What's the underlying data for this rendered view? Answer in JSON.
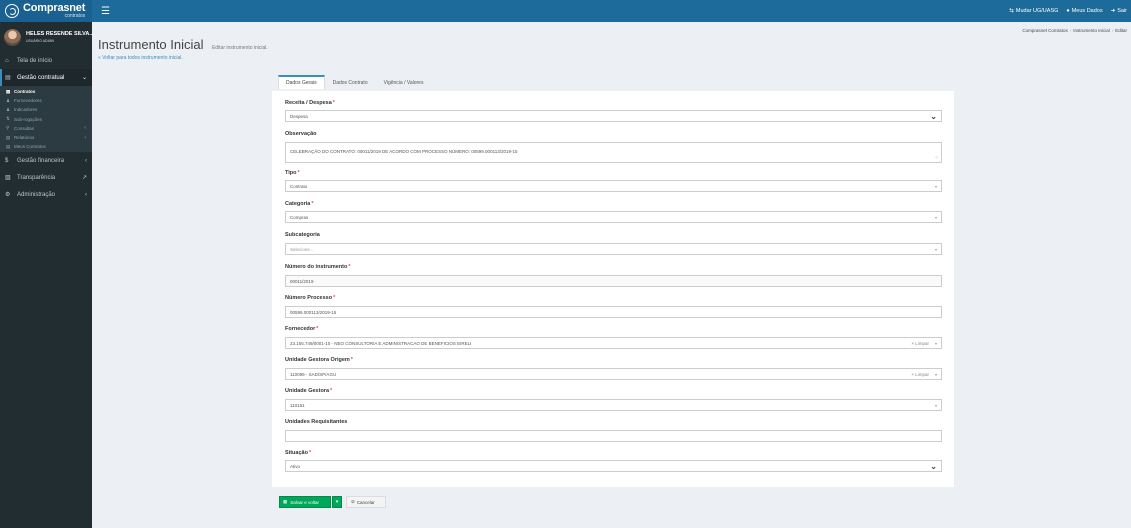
{
  "brand": {
    "title": "Comprasnet",
    "subtitle": "contratos"
  },
  "topbar": {
    "menu_icon": "hamburger-icon",
    "actions": [
      {
        "label": "Mudar UG/UASG",
        "icon": "swap-icon"
      },
      {
        "label": "Meus Dados",
        "icon": "user-icon"
      },
      {
        "label": "Sair",
        "icon": "logout-icon"
      }
    ]
  },
  "user": {
    "name": "HELES RESENDE SILVA...",
    "role": "USUÁRIO ADMIN"
  },
  "sidebar": {
    "items": [
      {
        "label": "Tela de início",
        "icon": "home-icon"
      },
      {
        "label": "Gestão contratual",
        "icon": "file-icon",
        "expanded": true
      },
      {
        "label": "Gestão financeira",
        "icon": "dollar-icon"
      },
      {
        "label": "Transparência",
        "icon": "table-icon"
      },
      {
        "label": "Administração",
        "icon": "gears-icon"
      }
    ],
    "submenu": [
      {
        "label": "Contratos",
        "icon": "file-icon",
        "current": true
      },
      {
        "label": "Fornecedores",
        "icon": "users-icon"
      },
      {
        "label": "Indicadores",
        "icon": "users-icon"
      },
      {
        "label": "Sub-rogações",
        "icon": "exchange-icon"
      },
      {
        "label": "Consultas",
        "icon": "search-icon"
      },
      {
        "label": "Relatórios",
        "icon": "file-icon"
      },
      {
        "label": "Meus Contratos",
        "icon": "file-icon"
      }
    ]
  },
  "header": {
    "title": "Instrumento Inicial",
    "subtitle": "Editar instrumento inicial.",
    "back_link": "« Voltar para todos instrumento inicial."
  },
  "breadcrumb": [
    "Comprasnet Contratos",
    "Instrumento Inicial",
    "Editar"
  ],
  "tabs": [
    {
      "label": "Dados Gerais",
      "active": true
    },
    {
      "label": "Dados Contrato",
      "active": false
    },
    {
      "label": "Vigência / Valores",
      "active": false
    }
  ],
  "form": {
    "receita_despesa": {
      "label": "Receita / Despesa",
      "value": "Despesa"
    },
    "observacao": {
      "label": "Observação",
      "value": "CELEBRAÇÃO DO CONTRATO: 00011/2019 DE ACORDO COM PROCESSO NÚMERO: 00599.000113/2019-15"
    },
    "tipo": {
      "label": "Tipo",
      "value": "Contrato"
    },
    "categoria": {
      "label": "Categoria",
      "value": "Compras"
    },
    "subcategoria": {
      "label": "Subcategoria",
      "placeholder": "Selecione..."
    },
    "numero_instrumento": {
      "label": "Número do instrumento",
      "value": "00011/2019"
    },
    "numero_processo": {
      "label": "Número Processo",
      "value": "00599.000113/2019-15"
    },
    "fornecedor": {
      "label": "Fornecedor",
      "value": "23.155.749/0001-10 - NEO CONSULTORIA E ADMINISTRACAO DE BENEFICIOS EIRELI",
      "clear": "× Limpar"
    },
    "unidade_origem": {
      "label": "Unidade Gestora Origem",
      "value": "110099 - SAD/SP/AGU",
      "clear": "× Limpar"
    },
    "unidade_gestora": {
      "label": "Unidade Gestora",
      "value": "110161"
    },
    "unidades_requisitantes": {
      "label": "Unidades Requisitantes",
      "value": ""
    },
    "situacao": {
      "label": "Situação",
      "value": "Ativo"
    }
  },
  "buttons": {
    "save": "Salvar e voltar",
    "cancel": "Cancelar"
  },
  "colors": {
    "topbar": "#1d6b9b",
    "sidebar": "#222d32",
    "accent": "#3c8dbc",
    "save": "#00a65a",
    "required": "#dd4b39"
  }
}
